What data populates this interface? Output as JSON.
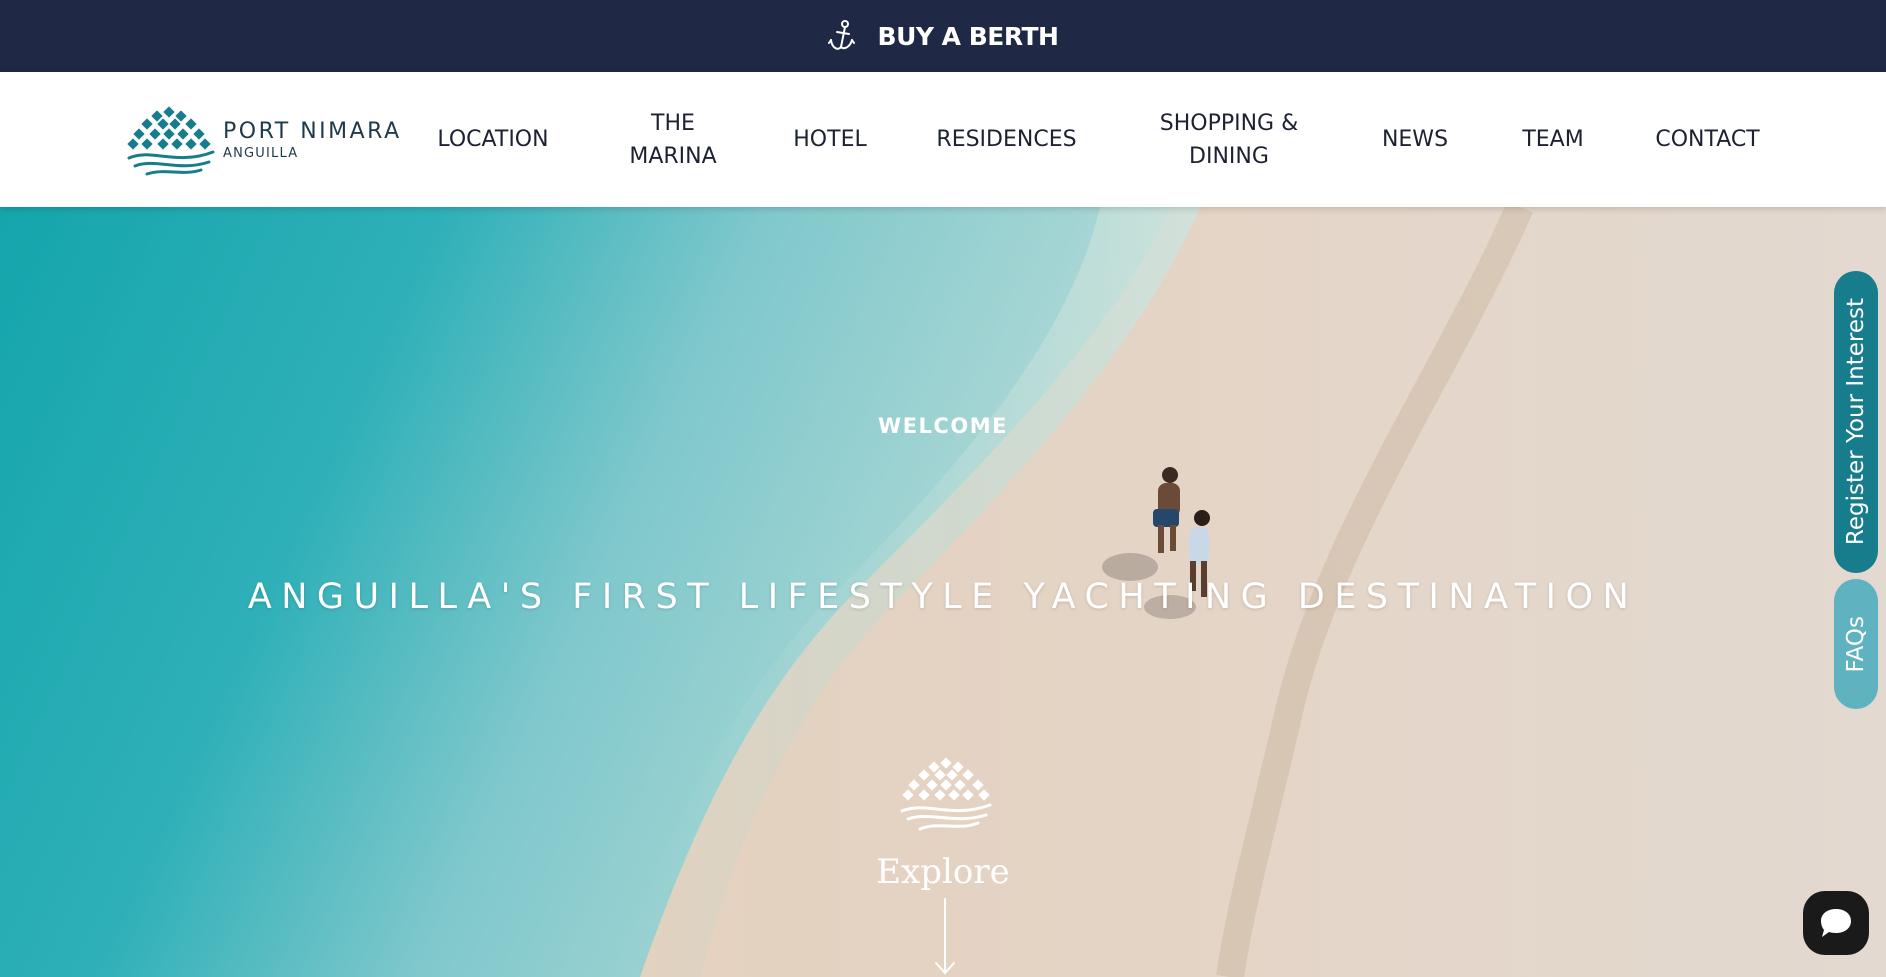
{
  "topbar": {
    "cta_label": "BUY A BERTH",
    "icon": "anchor-icon",
    "background": "#1f2845"
  },
  "header": {
    "logo": {
      "name": "PORT NIMARA",
      "sub": "ANGUILLA"
    },
    "nav": [
      {
        "line1": "LOCATION",
        "line2": ""
      },
      {
        "line1": "THE",
        "line2": "MARINA"
      },
      {
        "line1": "HOTEL",
        "line2": ""
      },
      {
        "line1": "RESIDENCES",
        "line2": ""
      },
      {
        "line1": "SHOPPING &",
        "line2": "DINING"
      },
      {
        "line1": "NEWS",
        "line2": ""
      },
      {
        "line1": "TEAM",
        "line2": ""
      },
      {
        "line1": "CONTACT",
        "line2": ""
      }
    ]
  },
  "hero": {
    "welcome": "WELCOME",
    "tagline": "ANGUILLA'S FIRST LIFESTYLE YACHTING DESTINATION",
    "explore": "Explore"
  },
  "side_tabs": {
    "register": "Register Your Interest",
    "faqs": "FAQs"
  },
  "colors": {
    "accent_teal": "#177c8b",
    "light_teal": "#5fb3c1",
    "navy": "#1f2845"
  }
}
